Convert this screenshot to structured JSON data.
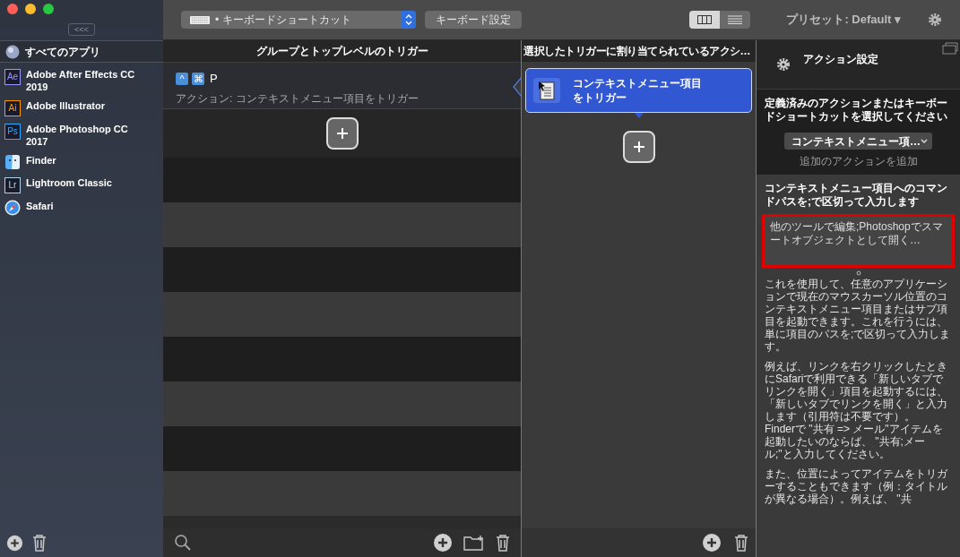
{
  "toolbar": {
    "trigger_type": "• キーボードショートカット",
    "keyboard_settings_button": "キーボード設定",
    "view_modes": [
      {
        "kind": "columns",
        "selected": true
      },
      {
        "kind": "list",
        "selected": false
      }
    ],
    "preset": "プリセット: Default ▾"
  },
  "sidebar": {
    "collapse_button": "<<<",
    "all_apps": {
      "label": "すべてのアプリ",
      "selected": true
    },
    "items": [
      {
        "label": "Adobe After Effects CC 2019",
        "icon": "Ae",
        "color": "#9999ff"
      },
      {
        "label": "Adobe Illustrator",
        "icon": "Ai",
        "color": "#ff9a00"
      },
      {
        "label": "Adobe Photoshop CC 2017",
        "icon": "Ps",
        "color": "#31a8ff"
      },
      {
        "label": "Finder",
        "kind": "finder"
      },
      {
        "label": "Lightroom Classic",
        "icon": "Lr",
        "color": "#add5ec"
      },
      {
        "label": "Safari",
        "kind": "safari"
      }
    ]
  },
  "triggers": {
    "header": "グループとトップレベルのトリガー",
    "items": [
      {
        "keys": [
          "^",
          "⌘"
        ],
        "key": "P",
        "action": "アクション: コンテキストメニュー項目をトリガー",
        "selected": true
      }
    ]
  },
  "actions": {
    "header": "選択したトリガーに割り当てられているアクシ…",
    "items": [
      {
        "label": "コンテキストメニュー項目をトリガー",
        "selected": true
      }
    ]
  },
  "inspector": {
    "title": "アクション設定",
    "prompt": "定義済みのアクションまたはキーボードショートカットを選択してください",
    "action_select": "コンテキストメニュー項…",
    "add_action_link": "追加のアクションを追加",
    "path_label": "コンテキストメニュー項目へのコマンドパスを;で区切って入力します",
    "path_value": "他のツールで編集;Photoshopでスマートオブジェクトとして開く…",
    "highlighted": true,
    "help": [
      "これを使用して、任意のアプリケーションで現在のマウスカーソル位置のコンテキストメニュー項目またはサブ項目を起動できます。これを行うには、単に項目のパスを;で区切って入力します。",
      "例えば、リンクを右クリックしたときにSafariで利用できる「新しいタブでリンクを開く」項目を起動するには、「新しいタブでリンクを開く」と入力します（引用符は不要です）。\nFinderで \"共有 => メール\"アイテムを起動したいのならば、 \"共有;メール;\"と入力してください。",
      "また、位置によってアイテムをトリガーすることもできます（例：タイトルが異なる場合）。例えば、 \"共"
    ]
  }
}
